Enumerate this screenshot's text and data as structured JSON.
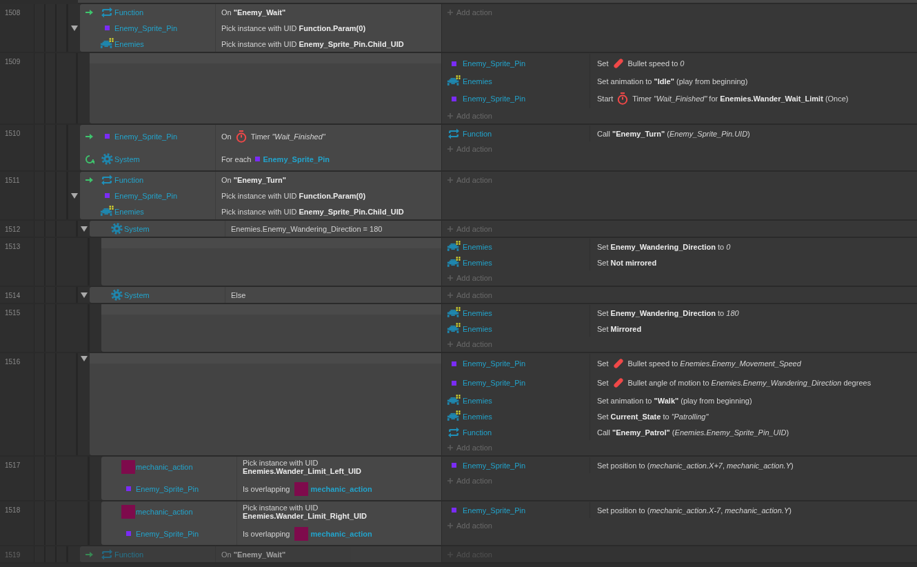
{
  "events": [
    {
      "number": "1508",
      "disabled": false,
      "expanded": true,
      "add_label": "Add action",
      "conditions": [
        {
          "trigger": true,
          "loop": false,
          "kind": "function",
          "object": "Function",
          "text": [
            {
              "kind": "text",
              "text": "On **\"Enemy_Wait\"**"
            }
          ]
        },
        {
          "trigger": false,
          "loop": false,
          "kind": "sprite",
          "object": "Enemy_Sprite_Pin",
          "text": [
            {
              "kind": "text",
              "text": "Pick instance with UID **Function.Param(0)**"
            }
          ]
        },
        {
          "trigger": false,
          "loop": false,
          "kind": "enemies",
          "object": "Enemies",
          "text": [
            {
              "kind": "text",
              "text": "Pick instance with UID **Enemy_Sprite_Pin.Child_UID**"
            }
          ]
        }
      ],
      "children": [
        {
          "number": "1509",
          "disabled": false,
          "add_label": "Add action",
          "actions": [
            {
              "kind": "sprite",
              "object": "Enemy_Sprite_Pin",
              "text": [
                {
                  "kind": "text",
                  "text": "Set"
                },
                {
                  "kind": "bullet"
                },
                {
                  "kind": "text",
                  "text": "Bullet speed to *0*"
                }
              ]
            },
            {
              "kind": "enemies",
              "object": "Enemies",
              "text": [
                {
                  "kind": "text",
                  "text": "Set animation to **\"Idle\"** (play from beginning)"
                }
              ]
            },
            {
              "kind": "sprite",
              "object": "Enemy_Sprite_Pin",
              "text": [
                {
                  "kind": "text",
                  "text": "Start"
                },
                {
                  "kind": "timer"
                },
                {
                  "kind": "text",
                  "text": "Timer *\"Wait_Finished\"* for **Enemies.Wander_Wait_Limit** (Once)"
                }
              ]
            }
          ]
        }
      ]
    },
    {
      "number": "1510",
      "disabled": false,
      "add_label": "Add action",
      "conditions": [
        {
          "trigger": true,
          "loop": false,
          "kind": "sprite",
          "object": "Enemy_Sprite_Pin",
          "text": [
            {
              "kind": "text",
              "text": "On"
            },
            {
              "kind": "timer"
            },
            {
              "kind": "text",
              "text": "Timer *\"Wait_Finished\"*"
            }
          ]
        },
        {
          "trigger": false,
          "loop": true,
          "kind": "system",
          "object": "System",
          "text": [
            {
              "kind": "text",
              "text": "For each"
            },
            {
              "kind": "sprite_ref",
              "text": "Enemy_Sprite_Pin"
            }
          ]
        }
      ],
      "actions": [
        {
          "kind": "function",
          "object": "Function",
          "text": [
            {
              "kind": "text",
              "text": "Call **\"Enemy_Turn\"** (*Enemy_Sprite_Pin.UID*)"
            }
          ]
        }
      ]
    },
    {
      "number": "1511",
      "disabled": false,
      "expanded": true,
      "add_label": "Add action",
      "conditions": [
        {
          "trigger": true,
          "loop": false,
          "kind": "function",
          "object": "Function",
          "text": [
            {
              "kind": "text",
              "text": "On **\"Enemy_Turn\"**"
            }
          ]
        },
        {
          "trigger": false,
          "loop": false,
          "kind": "sprite",
          "object": "Enemy_Sprite_Pin",
          "text": [
            {
              "kind": "text",
              "text": "Pick instance with UID **Function.Param(0)**"
            }
          ]
        },
        {
          "trigger": false,
          "loop": false,
          "kind": "enemies",
          "object": "Enemies",
          "text": [
            {
              "kind": "text",
              "text": "Pick instance with UID **Enemy_Sprite_Pin.Child_UID**"
            }
          ]
        }
      ],
      "children": [
        {
          "number": "1512",
          "disabled": false,
          "expanded": true,
          "add_label": "Add action",
          "conditions": [
            {
              "trigger": false,
              "loop": false,
              "kind": "system",
              "object": "System",
              "text": [
                {
                  "kind": "text",
                  "text": "Enemies.Enemy_Wandering_Direction = 180"
                }
              ]
            }
          ],
          "children": [
            {
              "number": "1513",
              "disabled": false,
              "add_label": "Add action",
              "actions": [
                {
                  "kind": "enemies",
                  "object": "Enemies",
                  "text": [
                    {
                      "kind": "text",
                      "text": "Set **Enemy_Wandering_Direction** to *0*"
                    }
                  ]
                },
                {
                  "kind": "enemies",
                  "object": "Enemies",
                  "text": [
                    {
                      "kind": "text",
                      "text": "Set **Not mirrored**"
                    }
                  ]
                }
              ]
            }
          ]
        },
        {
          "number": "1514",
          "disabled": false,
          "expanded": true,
          "add_label": "Add action",
          "conditions": [
            {
              "trigger": false,
              "loop": false,
              "kind": "system",
              "object": "System",
              "text": [
                {
                  "kind": "text",
                  "text": "Else"
                }
              ]
            }
          ],
          "children": [
            {
              "number": "1515",
              "disabled": false,
              "add_label": "Add action",
              "actions": [
                {
                  "kind": "enemies",
                  "object": "Enemies",
                  "text": [
                    {
                      "kind": "text",
                      "text": "Set **Enemy_Wandering_Direction** to *180*"
                    }
                  ]
                },
                {
                  "kind": "enemies",
                  "object": "Enemies",
                  "text": [
                    {
                      "kind": "text",
                      "text": "Set **Mirrored**"
                    }
                  ]
                }
              ]
            }
          ]
        },
        {
          "number": "1516",
          "disabled": false,
          "expanded": true,
          "add_label": "Add action",
          "actions": [
            {
              "kind": "sprite",
              "object": "Enemy_Sprite_Pin",
              "text": [
                {
                  "kind": "text",
                  "text": "Set"
                },
                {
                  "kind": "bullet"
                },
                {
                  "kind": "text",
                  "text": "Bullet speed to *Enemies.Enemy_Movement_Speed*"
                }
              ]
            },
            {
              "kind": "sprite",
              "object": "Enemy_Sprite_Pin",
              "text": [
                {
                  "kind": "text",
                  "text": "Set"
                },
                {
                  "kind": "bullet"
                },
                {
                  "kind": "text",
                  "text": "Bullet angle of motion to *Enemies.Enemy_Wandering_Direction* degrees"
                }
              ]
            },
            {
              "kind": "enemies",
              "object": "Enemies",
              "text": [
                {
                  "kind": "text",
                  "text": "Set animation to **\"Walk\"** (play from beginning)"
                }
              ]
            },
            {
              "kind": "enemies",
              "object": "Enemies",
              "text": [
                {
                  "kind": "text",
                  "text": "Set **Current_State** to *\"Patrolling\"*"
                }
              ]
            },
            {
              "kind": "function",
              "object": "Function",
              "text": [
                {
                  "kind": "text",
                  "text": "Call **\"Enemy_Patrol\"** (*Enemies.Enemy_Sprite_Pin_UID*)"
                }
              ]
            }
          ],
          "children": [
            {
              "number": "1517",
              "disabled": false,
              "add_label": "Add action",
              "conditions": [
                {
                  "trigger": false,
                  "loop": false,
                  "kind": "tiled",
                  "object": "mechanic_action",
                  "text": [
                    {
                      "kind": "text",
                      "text": "Pick instance with UID **Enemies.Wander_Limit_Left_UID**"
                    }
                  ]
                },
                {
                  "trigger": false,
                  "loop": false,
                  "kind": "sprite",
                  "object": "Enemy_Sprite_Pin",
                  "text": [
                    {
                      "kind": "text",
                      "text": "Is overlapping"
                    },
                    {
                      "kind": "tiled_ref",
                      "text": "mechanic_action"
                    }
                  ]
                }
              ],
              "actions": [
                {
                  "kind": "sprite",
                  "object": "Enemy_Sprite_Pin",
                  "text": [
                    {
                      "kind": "text",
                      "text": "Set position to (*mechanic_action.X+7*, *mechanic_action.Y*)"
                    }
                  ]
                }
              ]
            },
            {
              "number": "1518",
              "disabled": false,
              "add_label": "Add action",
              "conditions": [
                {
                  "trigger": false,
                  "loop": false,
                  "kind": "tiled",
                  "object": "mechanic_action",
                  "text": [
                    {
                      "kind": "text",
                      "text": "Pick instance with UID **Enemies.Wander_Limit_Right_UID**"
                    }
                  ]
                },
                {
                  "trigger": false,
                  "loop": false,
                  "kind": "sprite",
                  "object": "Enemy_Sprite_Pin",
                  "text": [
                    {
                      "kind": "text",
                      "text": "Is overlapping"
                    },
                    {
                      "kind": "tiled_ref",
                      "text": "mechanic_action"
                    }
                  ]
                }
              ],
              "actions": [
                {
                  "kind": "sprite",
                  "object": "Enemy_Sprite_Pin",
                  "text": [
                    {
                      "kind": "text",
                      "text": "Set position to (*mechanic_action.X-7*, *mechanic_action.Y*)"
                    }
                  ]
                }
              ]
            }
          ]
        }
      ]
    },
    {
      "number": "1519",
      "disabled": true,
      "add_label": "Add action",
      "conditions": [
        {
          "trigger": true,
          "loop": false,
          "kind": "function",
          "object": "Function",
          "text": [
            {
              "kind": "text",
              "text": "On **\"Enemy_Wait\"**"
            }
          ]
        }
      ]
    }
  ]
}
